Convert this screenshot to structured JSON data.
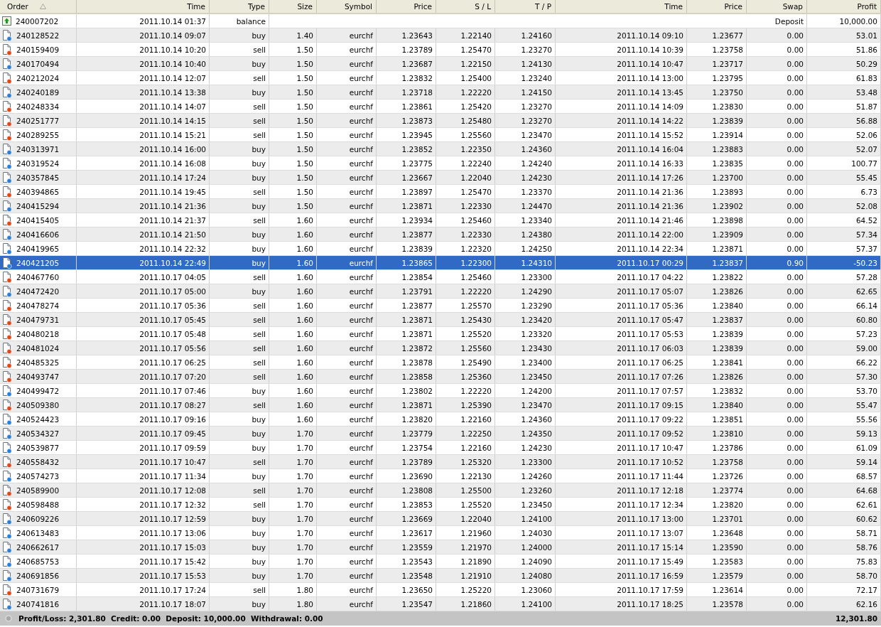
{
  "columns": [
    {
      "label": "Order",
      "sorted": true
    },
    {
      "label": "Time",
      "sorted": false
    },
    {
      "label": "Type",
      "sorted": false
    },
    {
      "label": "Size",
      "sorted": false
    },
    {
      "label": "Symbol",
      "sorted": false
    },
    {
      "label": "Price",
      "sorted": false
    },
    {
      "label": "S / L",
      "sorted": false
    },
    {
      "label": "T / P",
      "sorted": false
    },
    {
      "label": "Time",
      "sorted": false
    },
    {
      "label": "Price",
      "sorted": false
    },
    {
      "label": "Swap",
      "sorted": false
    },
    {
      "label": "Profit",
      "sorted": false
    }
  ],
  "rows": [
    {
      "kind": "balance",
      "order": "240007202",
      "cells": [
        "2011.10.14 01:37",
        "balance"
      ],
      "comment": "Deposit",
      "profit": "10,000.00",
      "selected": false
    },
    {
      "kind": "buy",
      "order": "240128522",
      "cells": [
        "2011.10.14 09:07",
        "buy",
        "1.40",
        "eurchf",
        "1.23643",
        "1.22140",
        "1.24160",
        "2011.10.14 09:10",
        "1.23677",
        "0.00",
        "53.01"
      ],
      "selected": false
    },
    {
      "kind": "sell",
      "order": "240159409",
      "cells": [
        "2011.10.14 10:20",
        "sell",
        "1.50",
        "eurchf",
        "1.23789",
        "1.25470",
        "1.23270",
        "2011.10.14 10:39",
        "1.23758",
        "0.00",
        "51.86"
      ],
      "selected": false
    },
    {
      "kind": "buy",
      "order": "240170494",
      "cells": [
        "2011.10.14 10:40",
        "buy",
        "1.50",
        "eurchf",
        "1.23687",
        "1.22150",
        "1.24130",
        "2011.10.14 10:47",
        "1.23717",
        "0.00",
        "50.29"
      ],
      "selected": false
    },
    {
      "kind": "sell",
      "order": "240212024",
      "cells": [
        "2011.10.14 12:07",
        "sell",
        "1.50",
        "eurchf",
        "1.23832",
        "1.25400",
        "1.23240",
        "2011.10.14 13:00",
        "1.23795",
        "0.00",
        "61.83"
      ],
      "selected": false
    },
    {
      "kind": "buy",
      "order": "240240189",
      "cells": [
        "2011.10.14 13:38",
        "buy",
        "1.50",
        "eurchf",
        "1.23718",
        "1.22220",
        "1.24150",
        "2011.10.14 13:45",
        "1.23750",
        "0.00",
        "53.48"
      ],
      "selected": false
    },
    {
      "kind": "sell",
      "order": "240248334",
      "cells": [
        "2011.10.14 14:07",
        "sell",
        "1.50",
        "eurchf",
        "1.23861",
        "1.25420",
        "1.23270",
        "2011.10.14 14:09",
        "1.23830",
        "0.00",
        "51.87"
      ],
      "selected": false
    },
    {
      "kind": "sell",
      "order": "240251777",
      "cells": [
        "2011.10.14 14:15",
        "sell",
        "1.50",
        "eurchf",
        "1.23873",
        "1.25480",
        "1.23270",
        "2011.10.14 14:22",
        "1.23839",
        "0.00",
        "56.88"
      ],
      "selected": false
    },
    {
      "kind": "sell",
      "order": "240289255",
      "cells": [
        "2011.10.14 15:21",
        "sell",
        "1.50",
        "eurchf",
        "1.23945",
        "1.25560",
        "1.23470",
        "2011.10.14 15:52",
        "1.23914",
        "0.00",
        "52.06"
      ],
      "selected": false
    },
    {
      "kind": "buy",
      "order": "240313971",
      "cells": [
        "2011.10.14 16:00",
        "buy",
        "1.50",
        "eurchf",
        "1.23852",
        "1.22350",
        "1.24360",
        "2011.10.14 16:04",
        "1.23883",
        "0.00",
        "52.07"
      ],
      "selected": false
    },
    {
      "kind": "buy",
      "order": "240319524",
      "cells": [
        "2011.10.14 16:08",
        "buy",
        "1.50",
        "eurchf",
        "1.23775",
        "1.22240",
        "1.24240",
        "2011.10.14 16:33",
        "1.23835",
        "0.00",
        "100.77"
      ],
      "selected": false
    },
    {
      "kind": "buy",
      "order": "240357845",
      "cells": [
        "2011.10.14 17:24",
        "buy",
        "1.50",
        "eurchf",
        "1.23667",
        "1.22040",
        "1.24230",
        "2011.10.14 17:26",
        "1.23700",
        "0.00",
        "55.45"
      ],
      "selected": false
    },
    {
      "kind": "sell",
      "order": "240394865",
      "cells": [
        "2011.10.14 19:45",
        "sell",
        "1.50",
        "eurchf",
        "1.23897",
        "1.25470",
        "1.23370",
        "2011.10.14 21:36",
        "1.23893",
        "0.00",
        "6.73"
      ],
      "selected": false
    },
    {
      "kind": "buy",
      "order": "240415294",
      "cells": [
        "2011.10.14 21:36",
        "buy",
        "1.50",
        "eurchf",
        "1.23871",
        "1.22330",
        "1.24470",
        "2011.10.14 21:36",
        "1.23902",
        "0.00",
        "52.08"
      ],
      "selected": false
    },
    {
      "kind": "sell",
      "order": "240415405",
      "cells": [
        "2011.10.14 21:37",
        "sell",
        "1.60",
        "eurchf",
        "1.23934",
        "1.25460",
        "1.23340",
        "2011.10.14 21:46",
        "1.23898",
        "0.00",
        "64.52"
      ],
      "selected": false
    },
    {
      "kind": "buy",
      "order": "240416606",
      "cells": [
        "2011.10.14 21:50",
        "buy",
        "1.60",
        "eurchf",
        "1.23877",
        "1.22330",
        "1.24380",
        "2011.10.14 22:00",
        "1.23909",
        "0.00",
        "57.34"
      ],
      "selected": false
    },
    {
      "kind": "buy",
      "order": "240419965",
      "cells": [
        "2011.10.14 22:32",
        "buy",
        "1.60",
        "eurchf",
        "1.23839",
        "1.22320",
        "1.24250",
        "2011.10.14 22:34",
        "1.23871",
        "0.00",
        "57.37"
      ],
      "selected": false
    },
    {
      "kind": "buy",
      "order": "240421205",
      "cells": [
        "2011.10.14 22:49",
        "buy",
        "1.60",
        "eurchf",
        "1.23865",
        "1.22300",
        "1.24310",
        "2011.10.17 00:29",
        "1.23837",
        "0.90",
        "-50.23"
      ],
      "selected": true
    },
    {
      "kind": "sell",
      "order": "240467760",
      "cells": [
        "2011.10.17 04:05",
        "sell",
        "1.60",
        "eurchf",
        "1.23854",
        "1.25460",
        "1.23300",
        "2011.10.17 04:22",
        "1.23822",
        "0.00",
        "57.28"
      ],
      "selected": false
    },
    {
      "kind": "buy",
      "order": "240472420",
      "cells": [
        "2011.10.17 05:00",
        "buy",
        "1.60",
        "eurchf",
        "1.23791",
        "1.22220",
        "1.24290",
        "2011.10.17 05:07",
        "1.23826",
        "0.00",
        "62.65"
      ],
      "selected": false
    },
    {
      "kind": "sell",
      "order": "240478274",
      "cells": [
        "2011.10.17 05:36",
        "sell",
        "1.60",
        "eurchf",
        "1.23877",
        "1.25570",
        "1.23290",
        "2011.10.17 05:36",
        "1.23840",
        "0.00",
        "66.14"
      ],
      "selected": false
    },
    {
      "kind": "sell",
      "order": "240479731",
      "cells": [
        "2011.10.17 05:45",
        "sell",
        "1.60",
        "eurchf",
        "1.23871",
        "1.25430",
        "1.23420",
        "2011.10.17 05:47",
        "1.23837",
        "0.00",
        "60.80"
      ],
      "selected": false
    },
    {
      "kind": "sell",
      "order": "240480218",
      "cells": [
        "2011.10.17 05:48",
        "sell",
        "1.60",
        "eurchf",
        "1.23871",
        "1.25520",
        "1.23320",
        "2011.10.17 05:53",
        "1.23839",
        "0.00",
        "57.23"
      ],
      "selected": false
    },
    {
      "kind": "sell",
      "order": "240481024",
      "cells": [
        "2011.10.17 05:56",
        "sell",
        "1.60",
        "eurchf",
        "1.23872",
        "1.25560",
        "1.23430",
        "2011.10.17 06:03",
        "1.23839",
        "0.00",
        "59.00"
      ],
      "selected": false
    },
    {
      "kind": "sell",
      "order": "240485325",
      "cells": [
        "2011.10.17 06:25",
        "sell",
        "1.60",
        "eurchf",
        "1.23878",
        "1.25490",
        "1.23400",
        "2011.10.17 06:25",
        "1.23841",
        "0.00",
        "66.22"
      ],
      "selected": false
    },
    {
      "kind": "sell",
      "order": "240493747",
      "cells": [
        "2011.10.17 07:20",
        "sell",
        "1.60",
        "eurchf",
        "1.23858",
        "1.25360",
        "1.23450",
        "2011.10.17 07:26",
        "1.23826",
        "0.00",
        "57.30"
      ],
      "selected": false
    },
    {
      "kind": "buy",
      "order": "240499472",
      "cells": [
        "2011.10.17 07:46",
        "buy",
        "1.60",
        "eurchf",
        "1.23802",
        "1.22220",
        "1.24200",
        "2011.10.17 07:57",
        "1.23832",
        "0.00",
        "53.70"
      ],
      "selected": false
    },
    {
      "kind": "sell",
      "order": "240509380",
      "cells": [
        "2011.10.17 08:27",
        "sell",
        "1.60",
        "eurchf",
        "1.23871",
        "1.25390",
        "1.23470",
        "2011.10.17 09:15",
        "1.23840",
        "0.00",
        "55.47"
      ],
      "selected": false
    },
    {
      "kind": "buy",
      "order": "240524423",
      "cells": [
        "2011.10.17 09:16",
        "buy",
        "1.60",
        "eurchf",
        "1.23820",
        "1.22160",
        "1.24360",
        "2011.10.17 09:22",
        "1.23851",
        "0.00",
        "55.56"
      ],
      "selected": false
    },
    {
      "kind": "buy",
      "order": "240534327",
      "cells": [
        "2011.10.17 09:45",
        "buy",
        "1.70",
        "eurchf",
        "1.23779",
        "1.22250",
        "1.24350",
        "2011.10.17 09:52",
        "1.23810",
        "0.00",
        "59.13"
      ],
      "selected": false
    },
    {
      "kind": "buy",
      "order": "240539877",
      "cells": [
        "2011.10.17 09:59",
        "buy",
        "1.70",
        "eurchf",
        "1.23754",
        "1.22160",
        "1.24230",
        "2011.10.17 10:47",
        "1.23786",
        "0.00",
        "61.09"
      ],
      "selected": false
    },
    {
      "kind": "sell",
      "order": "240558432",
      "cells": [
        "2011.10.17 10:47",
        "sell",
        "1.70",
        "eurchf",
        "1.23789",
        "1.25320",
        "1.23300",
        "2011.10.17 10:52",
        "1.23758",
        "0.00",
        "59.14"
      ],
      "selected": false
    },
    {
      "kind": "buy",
      "order": "240574273",
      "cells": [
        "2011.10.17 11:34",
        "buy",
        "1.70",
        "eurchf",
        "1.23690",
        "1.22130",
        "1.24260",
        "2011.10.17 11:44",
        "1.23726",
        "0.00",
        "68.57"
      ],
      "selected": false
    },
    {
      "kind": "sell",
      "order": "240589900",
      "cells": [
        "2011.10.17 12:08",
        "sell",
        "1.70",
        "eurchf",
        "1.23808",
        "1.25500",
        "1.23260",
        "2011.10.17 12:18",
        "1.23774",
        "0.00",
        "64.68"
      ],
      "selected": false
    },
    {
      "kind": "sell",
      "order": "240598488",
      "cells": [
        "2011.10.17 12:32",
        "sell",
        "1.70",
        "eurchf",
        "1.23853",
        "1.25520",
        "1.23450",
        "2011.10.17 12:34",
        "1.23820",
        "0.00",
        "62.61"
      ],
      "selected": false
    },
    {
      "kind": "buy",
      "order": "240609226",
      "cells": [
        "2011.10.17 12:59",
        "buy",
        "1.70",
        "eurchf",
        "1.23669",
        "1.22040",
        "1.24100",
        "2011.10.17 13:00",
        "1.23701",
        "0.00",
        "60.62"
      ],
      "selected": false
    },
    {
      "kind": "buy",
      "order": "240613483",
      "cells": [
        "2011.10.17 13:06",
        "buy",
        "1.70",
        "eurchf",
        "1.23617",
        "1.21960",
        "1.24030",
        "2011.10.17 13:07",
        "1.23648",
        "0.00",
        "58.71"
      ],
      "selected": false
    },
    {
      "kind": "buy",
      "order": "240662617",
      "cells": [
        "2011.10.17 15:03",
        "buy",
        "1.70",
        "eurchf",
        "1.23559",
        "1.21970",
        "1.24000",
        "2011.10.17 15:14",
        "1.23590",
        "0.00",
        "58.76"
      ],
      "selected": false
    },
    {
      "kind": "buy",
      "order": "240685753",
      "cells": [
        "2011.10.17 15:42",
        "buy",
        "1.70",
        "eurchf",
        "1.23543",
        "1.21890",
        "1.24090",
        "2011.10.17 15:49",
        "1.23583",
        "0.00",
        "75.83"
      ],
      "selected": false
    },
    {
      "kind": "buy",
      "order": "240691856",
      "cells": [
        "2011.10.17 15:53",
        "buy",
        "1.70",
        "eurchf",
        "1.23548",
        "1.21910",
        "1.24080",
        "2011.10.17 16:59",
        "1.23579",
        "0.00",
        "58.70"
      ],
      "selected": false
    },
    {
      "kind": "sell",
      "order": "240731679",
      "cells": [
        "2011.10.17 17:24",
        "sell",
        "1.80",
        "eurchf",
        "1.23650",
        "1.25220",
        "1.23060",
        "2011.10.17 17:59",
        "1.23614",
        "0.00",
        "72.17"
      ],
      "selected": false
    },
    {
      "kind": "buy",
      "order": "240741816",
      "cells": [
        "2011.10.17 18:07",
        "buy",
        "1.80",
        "eurchf",
        "1.23547",
        "1.21860",
        "1.24100",
        "2011.10.17 18:25",
        "1.23578",
        "0.00",
        "62.16"
      ],
      "selected": false
    }
  ],
  "summary": {
    "text": "Profit/Loss: 2,301.80  Credit: 0.00  Deposit: 10,000.00  Withdrawal: 0.00",
    "total": "12,301.80"
  }
}
